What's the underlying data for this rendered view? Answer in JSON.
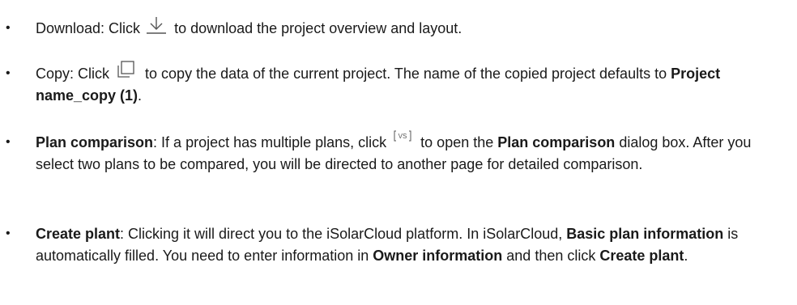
{
  "items": [
    {
      "pre": "Download: Click ",
      "post": " to download the project overview and layout.",
      "icon": "download-icon"
    },
    {
      "pre": "Copy: Click ",
      "mid": " to copy the data of the current project. The name of the copied project defaults to ",
      "bold1": "Project name_copy (1)",
      "post": ".",
      "icon": "copy-icon"
    },
    {
      "bold1": "Plan comparison",
      "mid1": ": If a project has multiple plans, click ",
      "mid2": " to open the ",
      "bold2": "Plan comparison",
      "post": " dialog box. After you select two plans to be compared, you will be directed to another page for detailed comparison.",
      "icon": "vs-icon",
      "icon_text": "VS"
    },
    {
      "bold1": "Create plant",
      "mid1": ": Clicking it will direct you to the iSolarCloud platform. In iSolarCloud, ",
      "bold2": "Basic plan information",
      "mid2": " is automatically filled. You need to enter information in ",
      "bold3": "Owner information",
      "mid3": " and then click ",
      "bold4": "Create plant",
      "post": "."
    }
  ],
  "bullet_char": "•",
  "colors": {
    "text": "#1a1a1a",
    "icon_stroke": "#555555"
  }
}
